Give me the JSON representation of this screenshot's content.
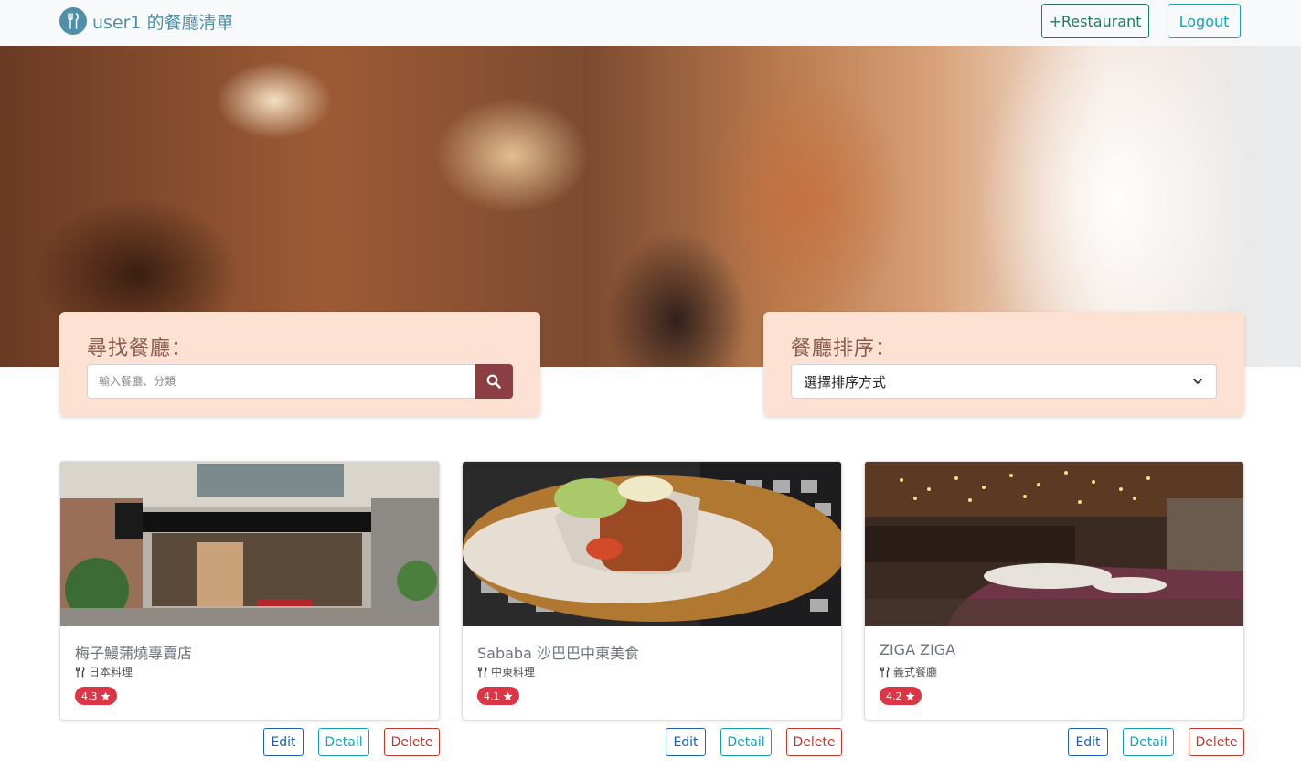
{
  "navbar": {
    "brand_title": "user1 的餐廳清單",
    "add_restaurant_label": "+Restaurant",
    "logout_label": "Logout"
  },
  "search": {
    "title": "尋找餐廳：",
    "placeholder": "輸入餐廳、分類"
  },
  "sort": {
    "title": "餐廳排序：",
    "selected": "選擇排序方式"
  },
  "restaurants": [
    {
      "name": "梅子鰻蒲燒專賣店",
      "category": "日本料理",
      "rating": "4.3"
    },
    {
      "name": "Sababa 沙巴巴中東美食",
      "category": "中東料理",
      "rating": "4.1"
    },
    {
      "name": "ZIGA ZIGA",
      "category": "義式餐廳",
      "rating": "4.2"
    }
  ],
  "card_buttons": {
    "edit": "Edit",
    "detail": "Detail",
    "delete": "Delete"
  },
  "colors": {
    "brand": "#4f8fa8",
    "panel_bg": "#fde2d3",
    "search_button": "#8b3f44",
    "badge": "#dc3545"
  }
}
